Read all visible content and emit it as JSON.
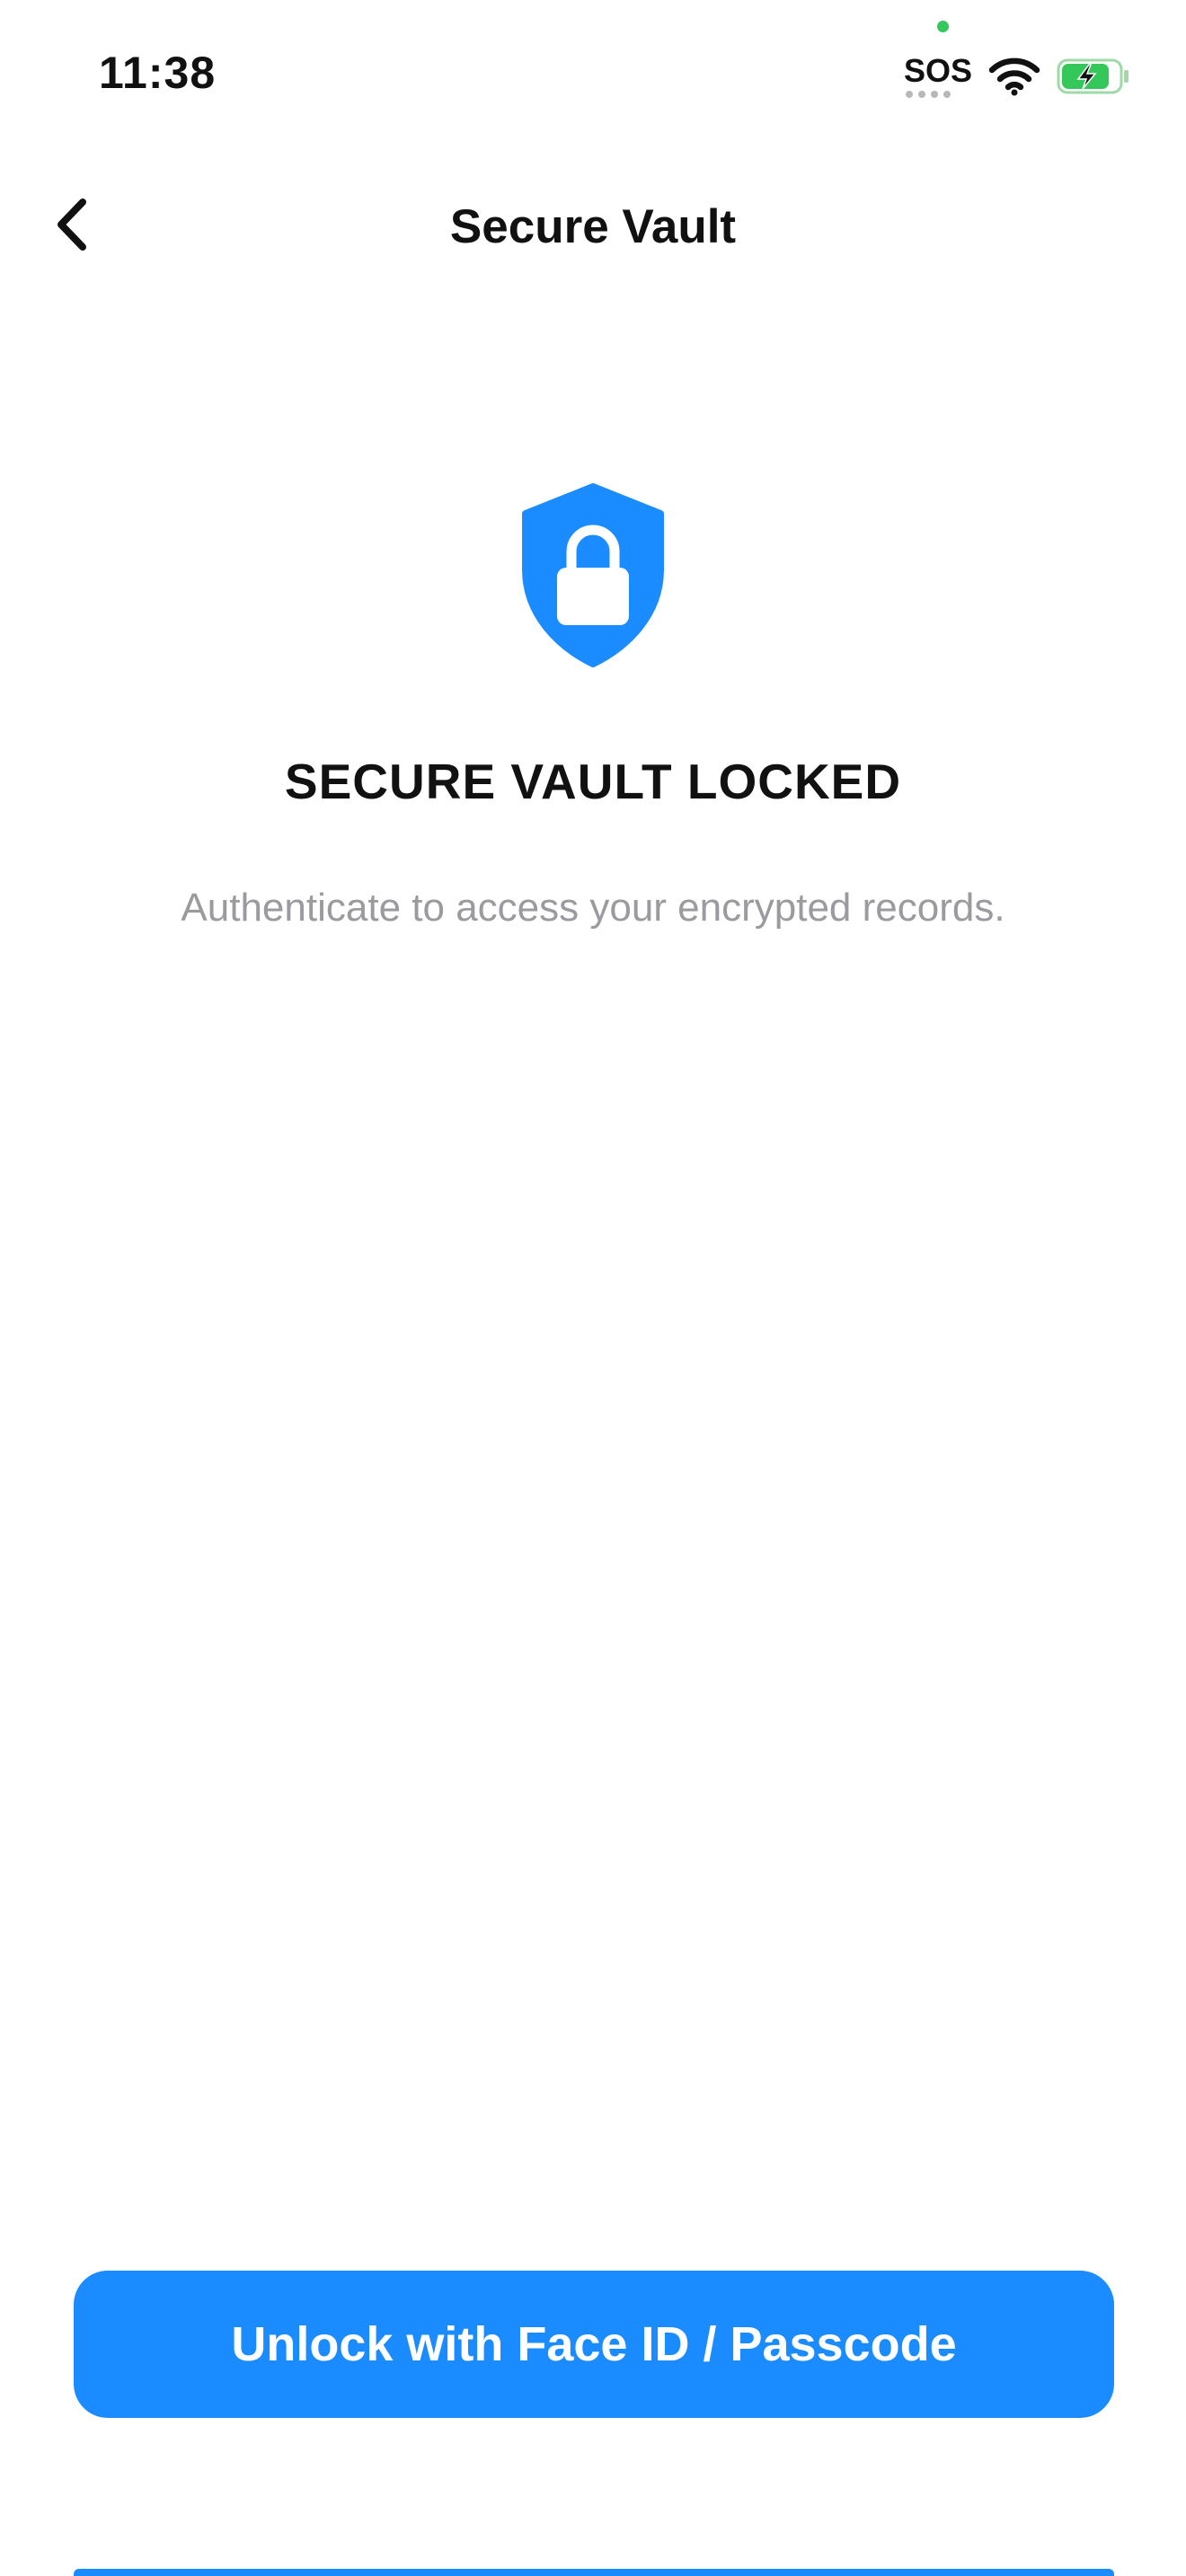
{
  "status_bar": {
    "time": "11:38",
    "sos": "SOS",
    "icons": [
      "green-privacy-dot",
      "wifi-icon",
      "battery-charging-icon"
    ],
    "battery_color": "#34c759"
  },
  "nav": {
    "back_icon": "chevron-left-icon",
    "title": "Secure Vault"
  },
  "lock_screen": {
    "icon": "shield-lock-icon",
    "icon_color": "#1a8cff",
    "title": "SECURE VAULT LOCKED",
    "subtitle": "Authenticate to access your encrypted records."
  },
  "actions": {
    "unlock_label": "Unlock with Face ID / Passcode",
    "accent_color": "#1a8cff"
  }
}
